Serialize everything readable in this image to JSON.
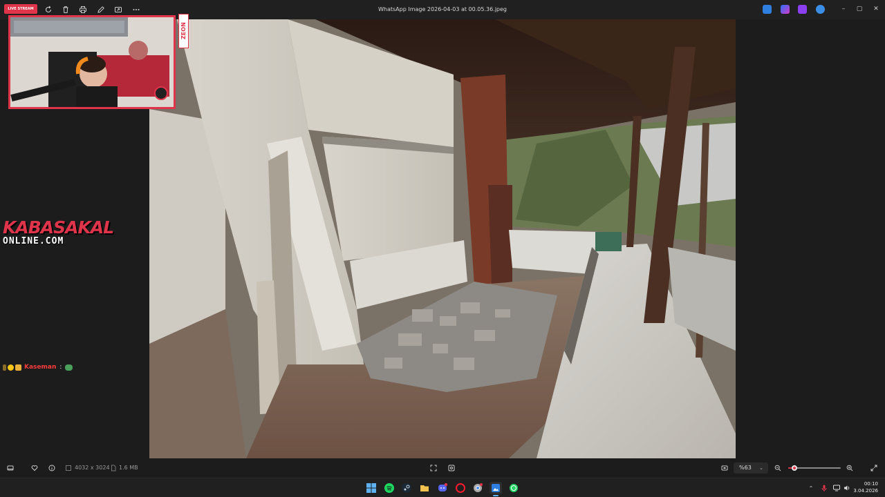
{
  "window": {
    "title": "WhatsApp Image 2026-04-03 at 00.05.36.jpeg",
    "toolbar_icons": [
      "rotate-icon",
      "delete-icon",
      "print-icon",
      "edit-icon",
      "share-icon",
      "more-icon"
    ],
    "controls": {
      "minimize": "–",
      "maximize": "▢",
      "close": "✕"
    }
  },
  "overlay": {
    "live_badge": "LIVE STREAM",
    "brand_tag": "ZEON",
    "logo_line1": "KABASAKAL",
    "logo_line2": "ONLINE.COM",
    "chat": {
      "user": "Kaseman",
      "separator": ":"
    }
  },
  "info": {
    "dimensions": "4032 x 3024",
    "file_size": "1.6 MB",
    "zoom_value": "%63",
    "zoom_level": 0.12
  },
  "clock": {
    "time": "00:10",
    "date": "3.04.2026"
  },
  "colors": {
    "accent": "#e0344a",
    "background": "#1c1c1c",
    "taskbar": "#202020",
    "windows_blue": "#5fb2f2"
  }
}
